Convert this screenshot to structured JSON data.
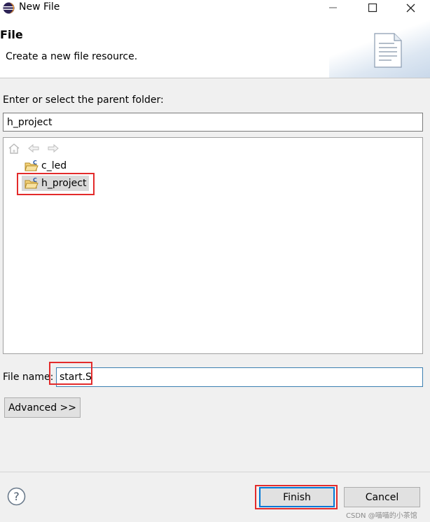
{
  "window": {
    "title": "New File",
    "controls": {
      "minimize": "–",
      "maximize": "☐",
      "close": "✕"
    }
  },
  "header": {
    "title": "File",
    "description": "Create a new file resource."
  },
  "parent_folder": {
    "label": "Enter or select the parent folder:",
    "value": "h_project"
  },
  "tree": {
    "nav_icons": [
      "home-icon",
      "back-arrow-icon",
      "forward-arrow-icon"
    ],
    "items": [
      {
        "label": "c_led",
        "icon": "c-project-folder-icon",
        "selected": false
      },
      {
        "label": "h_project",
        "icon": "c-project-folder-icon",
        "selected": true
      }
    ]
  },
  "file_name": {
    "label": "File name:",
    "value": "start.S"
  },
  "buttons": {
    "advanced": "Advanced >>",
    "finish": "Finish",
    "cancel": "Cancel",
    "help": "?"
  },
  "watermark": "CSDN @喵喵的小茶馆",
  "colors": {
    "highlight": "#e32b2b",
    "focus_border": "#0078d7",
    "selection": "#d9d9d9"
  }
}
